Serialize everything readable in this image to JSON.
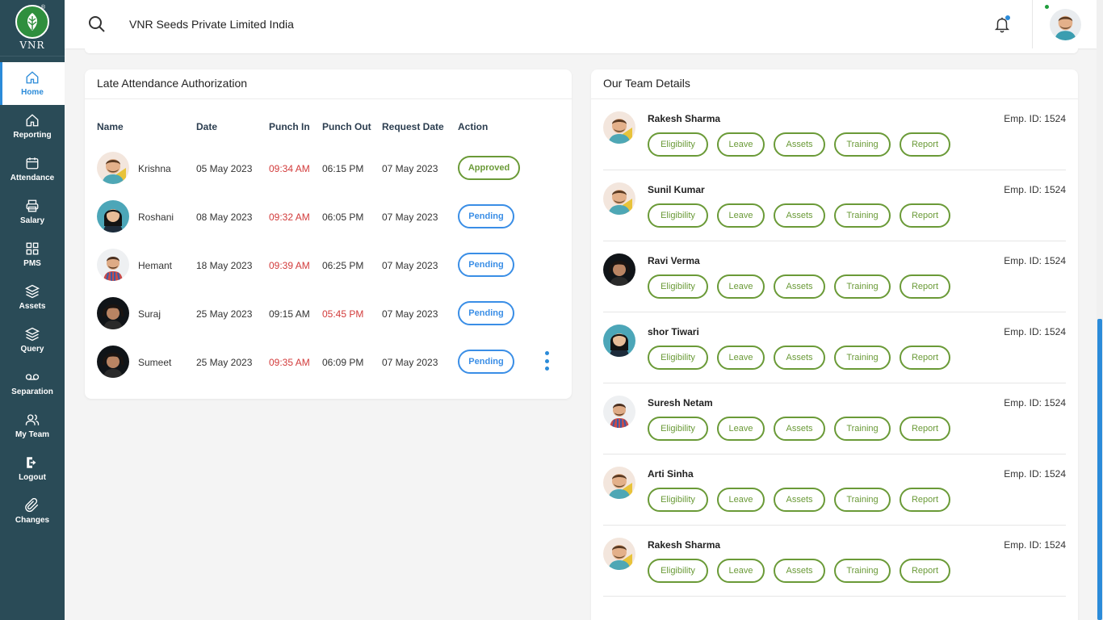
{
  "brand": {
    "logo_text": "VNR",
    "registered": "®"
  },
  "sidebar": {
    "items": [
      {
        "label": "Home",
        "icon": "home-icon"
      },
      {
        "label": "Reporting",
        "icon": "home-icon"
      },
      {
        "label": "Attendance",
        "icon": "calendar-icon"
      },
      {
        "label": "Salary",
        "icon": "printer-icon"
      },
      {
        "label": "PMS",
        "icon": "grid-icon"
      },
      {
        "label": "Assets",
        "icon": "layers-icon"
      },
      {
        "label": "Query",
        "icon": "layers-icon"
      },
      {
        "label": "Separation",
        "icon": "voicemail-icon"
      },
      {
        "label": "My Team",
        "icon": "users-icon"
      },
      {
        "label": "Logout",
        "icon": "logout-icon"
      },
      {
        "label": "Changes",
        "icon": "paperclip-icon"
      }
    ]
  },
  "header": {
    "company": "VNR Seeds Private Limited India"
  },
  "attendance": {
    "title": "Late Attendance Authorization",
    "columns": [
      "Name",
      "Date",
      "Punch In",
      "Punch Out",
      "Request Date",
      "Action"
    ],
    "rows": [
      {
        "name": "Krishna",
        "date": "05 May 2023",
        "punch_in": "09:34 AM",
        "punch_out": "06:15 PM",
        "request_date": "07 May 2023",
        "action": "Approved"
      },
      {
        "name": "Roshani",
        "date": "08 May 2023",
        "punch_in": "09:32 AM",
        "punch_out": "06:05 PM",
        "request_date": "07 May 2023",
        "action": "Pending"
      },
      {
        "name": "Hemant",
        "date": "18 May 2023",
        "punch_in": "09:39 AM",
        "punch_out": "06:25 PM",
        "request_date": "07 May 2023",
        "action": "Pending"
      },
      {
        "name": "Suraj",
        "date": "25 May 2023",
        "punch_in": "09:15 AM",
        "punch_out": "05:45 PM",
        "request_date": "07 May 2023",
        "action": "Pending"
      },
      {
        "name": "Sumeet",
        "date": "25 May 2023",
        "punch_in": "09:35 AM",
        "punch_out": "06:09 PM",
        "request_date": "07 May 2023",
        "action": "Pending"
      }
    ]
  },
  "team": {
    "title": "Our Team Details",
    "buttons": [
      "Eligibility",
      "Leave",
      "Assets",
      "Training",
      "Report"
    ],
    "members": [
      {
        "name": "Rakesh Sharma",
        "emp": "Emp. ID: 1524"
      },
      {
        "name": "Sunil Kumar",
        "emp": "Emp. ID: 1524"
      },
      {
        "name": "Ravi Verma",
        "emp": "Emp. ID: 1524"
      },
      {
        "name": "shor Tiwari",
        "emp": "Emp. ID: 1524"
      },
      {
        "name": "Suresh Netam",
        "emp": "Emp. ID: 1524"
      },
      {
        "name": "Arti Sinha",
        "emp": "Emp. ID: 1524"
      },
      {
        "name": "Rakesh Sharma",
        "emp": "Emp. ID: 1524"
      }
    ]
  },
  "colors": {
    "sidebar": "#2a4b57",
    "accent": "#2b8bd9",
    "green": "#6a9a37",
    "late": "#d23b3b"
  }
}
